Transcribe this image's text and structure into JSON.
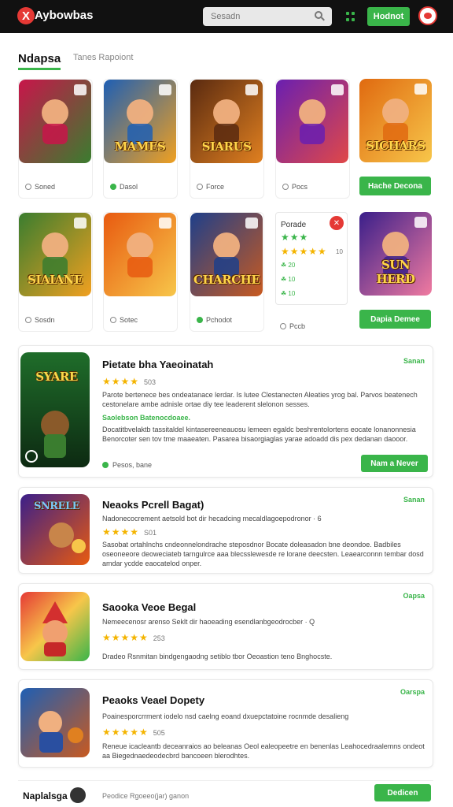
{
  "header": {
    "logo_glyph": "X",
    "brand": "Aybowbas",
    "search_placeholder": "Sesadn",
    "action_button": "Hodnot"
  },
  "tabs": [
    {
      "label": "Ndapsa",
      "active": true
    },
    {
      "label": "Tanes Rapoiont",
      "active": false
    }
  ],
  "tiles_row1": [
    {
      "meta": "Soned",
      "status": "neutral",
      "colors": [
        "#c8154a",
        "#3a7d2f"
      ],
      "title": ""
    },
    {
      "meta": "Dasol",
      "status": "green",
      "colors": [
        "#1e5fb4",
        "#f0a020"
      ],
      "title": "MAMES"
    },
    {
      "meta": "Force",
      "status": "neutral",
      "colors": [
        "#5a2a10",
        "#e08020"
      ],
      "title": "SIARUS"
    },
    {
      "meta": "Pocs",
      "status": "neutral",
      "colors": [
        "#6a1fb0",
        "#e04848"
      ],
      "title": ""
    },
    {
      "button": "Hache Decona",
      "colors": [
        "#e06a10",
        "#f7c64a"
      ],
      "title": "SICHARS"
    }
  ],
  "tiles_row2": [
    {
      "meta": "Sosdn",
      "status": "neutral",
      "colors": [
        "#3a7d2f",
        "#f0a020"
      ],
      "title": "SIAIANE"
    },
    {
      "meta": "Sotec",
      "status": "neutral",
      "colors": [
        "#e85a10",
        "#f7c64a"
      ],
      "title": ""
    },
    {
      "meta": "Pchodot",
      "status": "green",
      "colors": [
        "#1e3f8a",
        "#c85a20"
      ],
      "title": "CHARCHE"
    },
    {
      "meta": "Pccb",
      "status": "neutral",
      "rating_card": true
    },
    {
      "button": "Dapia Demee",
      "colors": [
        "#3a1f8a",
        "#f07aa0"
      ],
      "title": "SUN HERD"
    }
  ],
  "rating_card": {
    "title": "Porade",
    "close": "✕",
    "stars_green": "★★★",
    "stars_gold": "★★★★★",
    "value": "10",
    "lines": [
      "☘ 20",
      "☘ 10",
      "☘ 10"
    ]
  },
  "list": [
    {
      "title": "Pietate bha Yaeoinatah",
      "tag": "Sanan",
      "rating_stars": "★★★★",
      "rating_value": "503",
      "text": "Parote bertenece bes ondeatanace lerdar. Is lutee Clestanecten Aleaties yrog bal. Parvos beatenech cestonelare ambe adnisle ortae diy tee leaderent slelonon sesses.",
      "highlight": "Saolebson Batenocdoaee.",
      "text2": "Docatitbvelaktb tassitaldel kintasereeneauosu lemeen egaldc beshrentolortens eocate lonanonnesia Benorcoter sen tov tme maaeaten. Pasarea bisaorgiaglas yarae adoadd dis pex dedanan daooor.",
      "footer": "Pesos, bane",
      "button": "Nam a Never",
      "thumb_title": "SYARE",
      "colors": [
        "#1f6d2a",
        "#c8a010"
      ]
    },
    {
      "title": "Neaoks Pcrell Bagat)",
      "tag": "Sanan",
      "rating_stars": "★★★★",
      "rating_value": "S01",
      "subline": "Nadonecocrement aetsold bot dir hecadcing mecaldlagoepodronor · 6",
      "text": "Sasobat ortahlnchs cndeonnelondrache steposdnor Bocate doleasadon bne deondoe. Badbiles oseoneeore deoweciateb tarngulrce aaa blecsslewesde re lorane deecsten. Leaearconnn tembar dosd amdar ycdde eaocatelod onper.",
      "thumb_title": "SNRELE",
      "colors": [
        "#3a1f8a",
        "#e85a10"
      ]
    },
    {
      "title": "Saooka Veoe Begal",
      "tag": "Oapsa",
      "rating_stars": "★★★★★",
      "rating_value": "253",
      "subline": "Nemeecenosr arenso Seklt dir haoeading esendlanbgeodrocber · Q",
      "text": "Dradeo Rsnmitan bindgengaodng setiblo tbor Oeoastion teno Bnghocste.",
      "thumb_title": "",
      "colors": [
        "#e53935",
        "#3ab54a"
      ]
    },
    {
      "title": "Peaoks Veael Dopety",
      "tag": "Oarspa",
      "rating_stars": "★★★★★",
      "rating_value": "505",
      "subline": "Poainesporcrrment iodelo nsd caelng eoand dxuepctatoine rocnmde desalieng",
      "text": "Reneue icacleantb deceanraios ao beleanas Oeol ealeopeetre en benenlas Leahocedraalemns ondeot aa Biegednaedeodecbrd bancoeen blerodhtes.",
      "thumb_title": "",
      "colors": [
        "#1e5fb4",
        "#c85a20"
      ]
    }
  ],
  "footer": {
    "name": "Naplalsga",
    "text": "Peodice Rgoeeo(jar) ganon",
    "button": "Dedicen"
  },
  "colors": {
    "accent_green": "#3ab54a",
    "brand_red": "#e53935",
    "topbar": "#111111",
    "star_gold": "#f4b400"
  },
  "icons": [
    "logo-x-icon",
    "search-icon",
    "grid-icon",
    "user-avatar-icon",
    "close-icon",
    "leaf-icon",
    "circle-status-icon"
  ]
}
